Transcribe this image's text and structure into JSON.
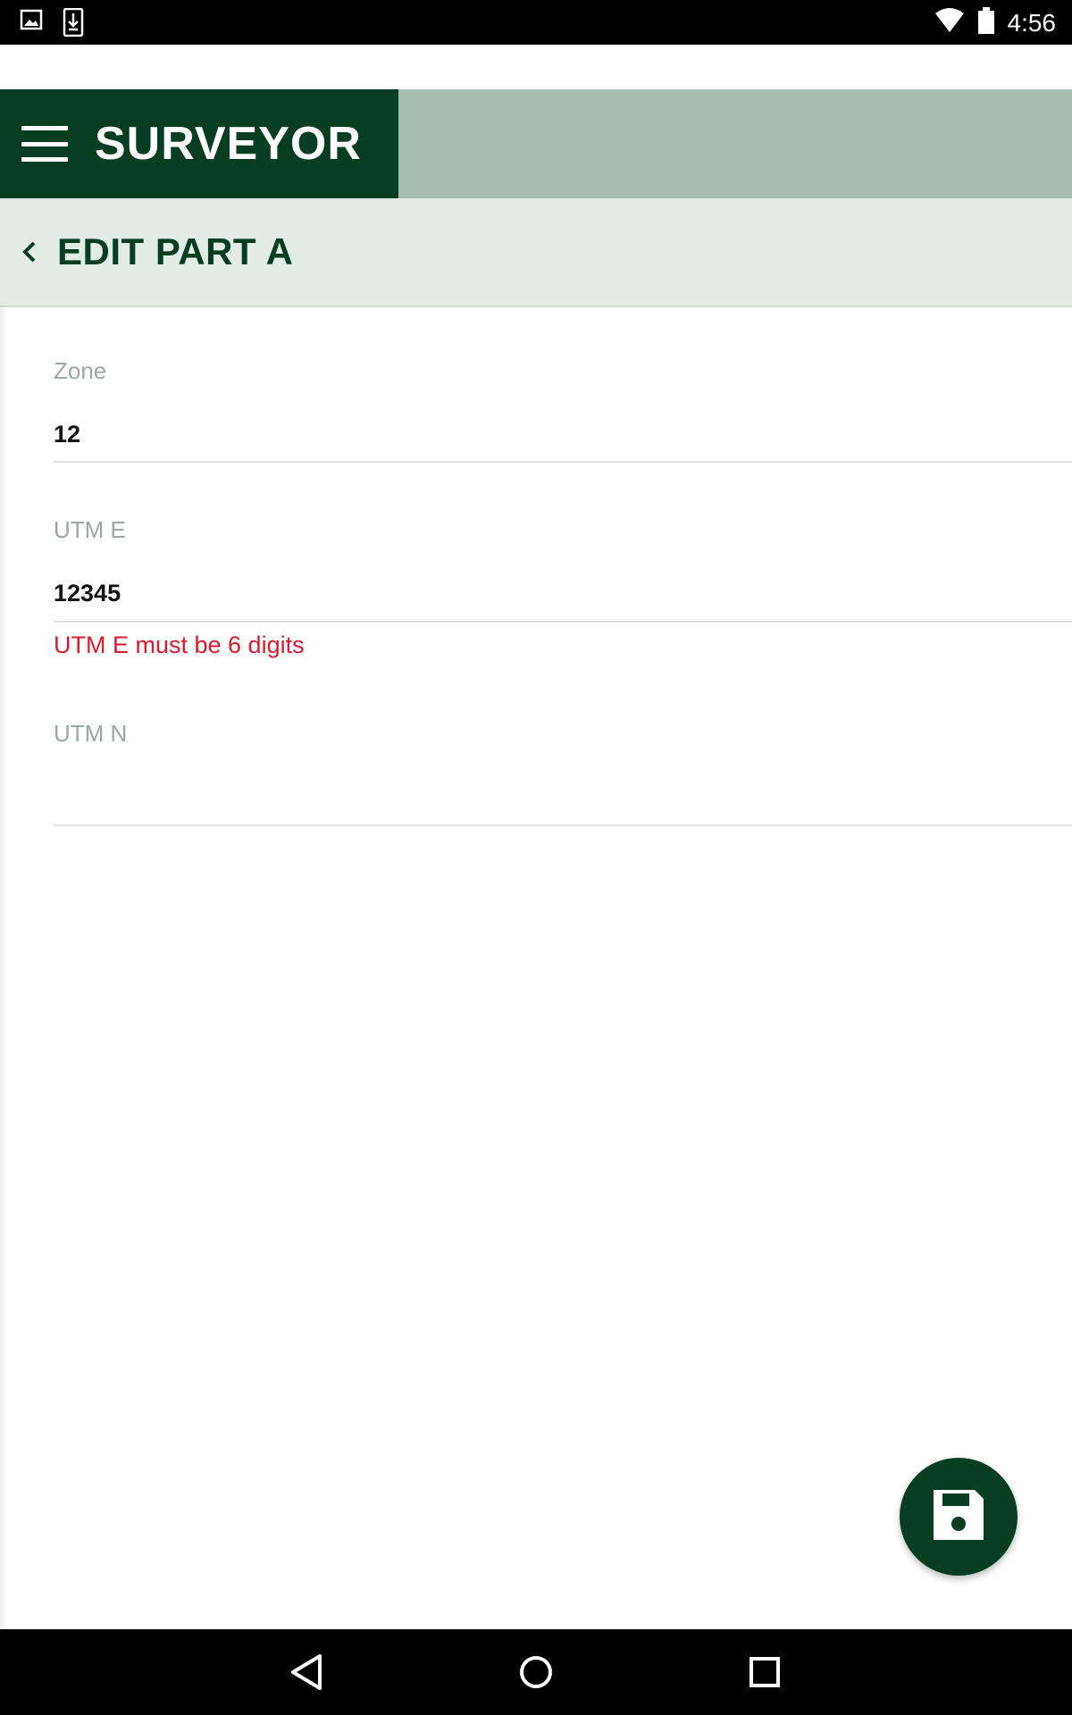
{
  "status_bar": {
    "time": "4:56",
    "icons": [
      "image-notification-icon",
      "download-notification-icon",
      "wifi-icon",
      "battery-icon"
    ]
  },
  "app_bar": {
    "title": "SURVEYOR",
    "menu_icon": "hamburger-menu-icon",
    "brand_color": "#073e22",
    "bar_color": "#a6bdb0"
  },
  "sub_bar": {
    "title": "EDIT PART A",
    "back_icon": "chevron-left-icon",
    "bg_color": "#e3ebe7"
  },
  "form": {
    "zone": {
      "label": "Zone",
      "value": "12"
    },
    "utm_e": {
      "label": "UTM E",
      "value": "12345",
      "error": "UTM E must be 6 digits"
    },
    "utm_n": {
      "label": "UTM N",
      "value": ""
    },
    "error_color": "#e0182d"
  },
  "fab": {
    "icon": "save-floppy-icon"
  },
  "nav_bar": {
    "icons": [
      "back-triangle-icon",
      "home-circle-icon",
      "recents-square-icon"
    ]
  }
}
